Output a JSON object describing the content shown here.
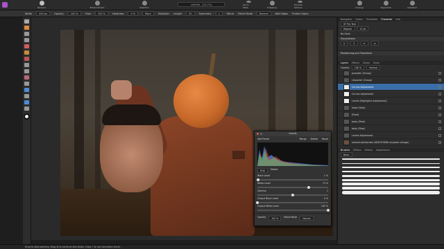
{
  "app": {
    "document_title": "untitled - [24.2%]"
  },
  "personas": [
    {
      "icon": "photo-persona-icon",
      "label": "Persona"
    },
    {
      "icon": "selection-icon",
      "label": "Enhancement"
    },
    {
      "icon": "selection-icon",
      "label": "Selection"
    },
    {
      "icon": "quick-mask-icon",
      "label": "Quick Mask"
    },
    {
      "icon": "snapping-icon",
      "label": "Snapping"
    },
    {
      "icon": "arrange-icon",
      "label": "Arrange"
    },
    {
      "icon": "alignment-icon",
      "label": "Alignment"
    },
    {
      "icon": "assistant-icon",
      "label": "Assistant"
    },
    {
      "icon": "brush-icon",
      "label": "Brush"
    },
    {
      "icon": "export-icon",
      "label": "Exclude Options"
    }
  ],
  "context_bar": {
    "width_label": "Width",
    "width_value": "454 px",
    "opacity_label": "Opacity",
    "opacity_value": "100 %",
    "flow_label": "Flow",
    "flow_value": "100 %",
    "hardness_label": "Hardness",
    "hardness_value": "0 %",
    "more": "More",
    "stabiliser": "Stabiliser",
    "length_label": "Length",
    "length_value": "20",
    "symmetry_label": "Symmetry",
    "symmetry_value": "1",
    "mirror": "Mirror",
    "lock_fill": "Lock Alpha",
    "blend_mode_label": "Blend Mode",
    "blend_mode_value": "Normal",
    "wet_edges": "Wet Edges",
    "protect_alpha": "Protect Alpha"
  },
  "right_panel": {
    "top_tabs": [
      "Navigator",
      "Colour",
      "Transform",
      "Character",
      "Info"
    ],
    "character": {
      "font": "SF Pro Text",
      "style": "Regular",
      "size": "12 pt",
      "language": "No Style"
    },
    "decorations_label": "Decorations",
    "positioning_label": "Positioning and Transform",
    "layers_tabs": [
      "Layers",
      "Effects",
      "Styles",
      "Stock"
    ],
    "opacity_label": "Opacity",
    "opacity_value": "100 %",
    "blend_value": "Normal",
    "layers": [
      {
        "name": "pumpkin (Group)",
        "selected": false
      },
      {
        "name": "character (Group)",
        "selected": false
      },
      {
        "name": "Curves Adjustment",
        "selected": true
      },
      {
        "name": "Curves Adjustment",
        "selected": false
      },
      {
        "name": "Levels (Highlights Adjustment)",
        "selected": false
      },
      {
        "name": "head (Pixel)",
        "selected": false
      },
      {
        "name": "(Pixel)",
        "selected": false
      },
      {
        "name": "body (Pixel)",
        "selected": false
      },
      {
        "name": "body (Pixel)",
        "selected": false
      },
      {
        "name": "Levels Adjustment",
        "selected": false
      },
      {
        "name": "samuel-dehkordee-1826797680 unsplash (Image)",
        "selected": false
      }
    ],
    "brushes_label": "Brushes",
    "brushes_tabs": [
      "Brushes",
      "Effects",
      "History",
      "Appearance"
    ],
    "brushes_category": "Basic"
  },
  "levels_dialog": {
    "title": "Levels",
    "add_preset": "Add Preset",
    "merge": "Merge",
    "delete": "Delete",
    "reset": "Reset",
    "channel": "RGB",
    "master": "Master",
    "black_level_label": "Black Level",
    "black_level_value": "1 %",
    "white_level_label": "White Level",
    "white_level_value": "73 %",
    "gamma_label": "Gamma",
    "gamma_value": "1",
    "output_black_label": "Output Black Level",
    "output_black_value": "0 %",
    "output_white_label": "Output White Level",
    "output_white_value": "100 %",
    "opacity_label": "Opacity",
    "opacity_value": "100 %",
    "blend_label": "Blend Mode",
    "blend_value": "Normal",
    "black_level_fraction": 0.01,
    "white_level_fraction": 0.73,
    "gamma_fraction": 0.5,
    "output_black_fraction": 0.0,
    "output_white_fraction": 1.0
  },
  "status_bar": {
    "text": "Drag to start painting. Drag ⌘ to continue last stroke. Drag ⇧ to use secondary brush."
  },
  "colors": {
    "accent": "#3a6ea8",
    "pumpkin": "#c8692a",
    "shirt": "#7a3a22"
  }
}
